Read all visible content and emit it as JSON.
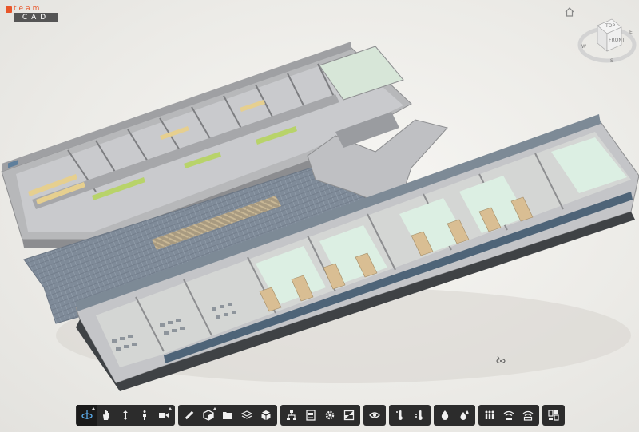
{
  "app": {
    "logo_top": "team",
    "logo_bottom": "CAD"
  },
  "viewcube": {
    "top_label": "TOP",
    "front_label": "FRONT",
    "compass_n": "N",
    "compass_e": "E",
    "compass_s": "S",
    "compass_w": "W"
  },
  "toolbar": {
    "groups": [
      {
        "name": "navigation",
        "buttons": [
          "orbit-icon",
          "pan-icon",
          "zoom-icon",
          "walk-icon",
          "camera-icon"
        ]
      },
      {
        "name": "tools",
        "buttons": [
          "measure-icon",
          "section-box-icon",
          "folder-icon",
          "layers-icon",
          "explode-icon"
        ]
      },
      {
        "name": "model",
        "buttons": [
          "model-browser-icon",
          "properties-icon",
          "settings-icon",
          "fullscreen-icon"
        ]
      },
      {
        "name": "view",
        "buttons": [
          "visibility-icon"
        ]
      },
      {
        "name": "analysis",
        "buttons": [
          "thermometer-icon",
          "sensor-icon"
        ]
      },
      {
        "name": "water",
        "buttons": [
          "drop-icon",
          "drop-multi-icon"
        ]
      },
      {
        "name": "occupancy",
        "buttons": [
          "people-icon",
          "wifi-icon",
          "wifi-alert-icon"
        ]
      },
      {
        "name": "dashboard",
        "buttons": [
          "dashboard-icon"
        ]
      }
    ]
  },
  "colors": {
    "accent": "#e8562a",
    "toolbar_bg": "#2c2c2c",
    "icon": "#f0f0f0",
    "active_icon": "#5aa9e6"
  }
}
